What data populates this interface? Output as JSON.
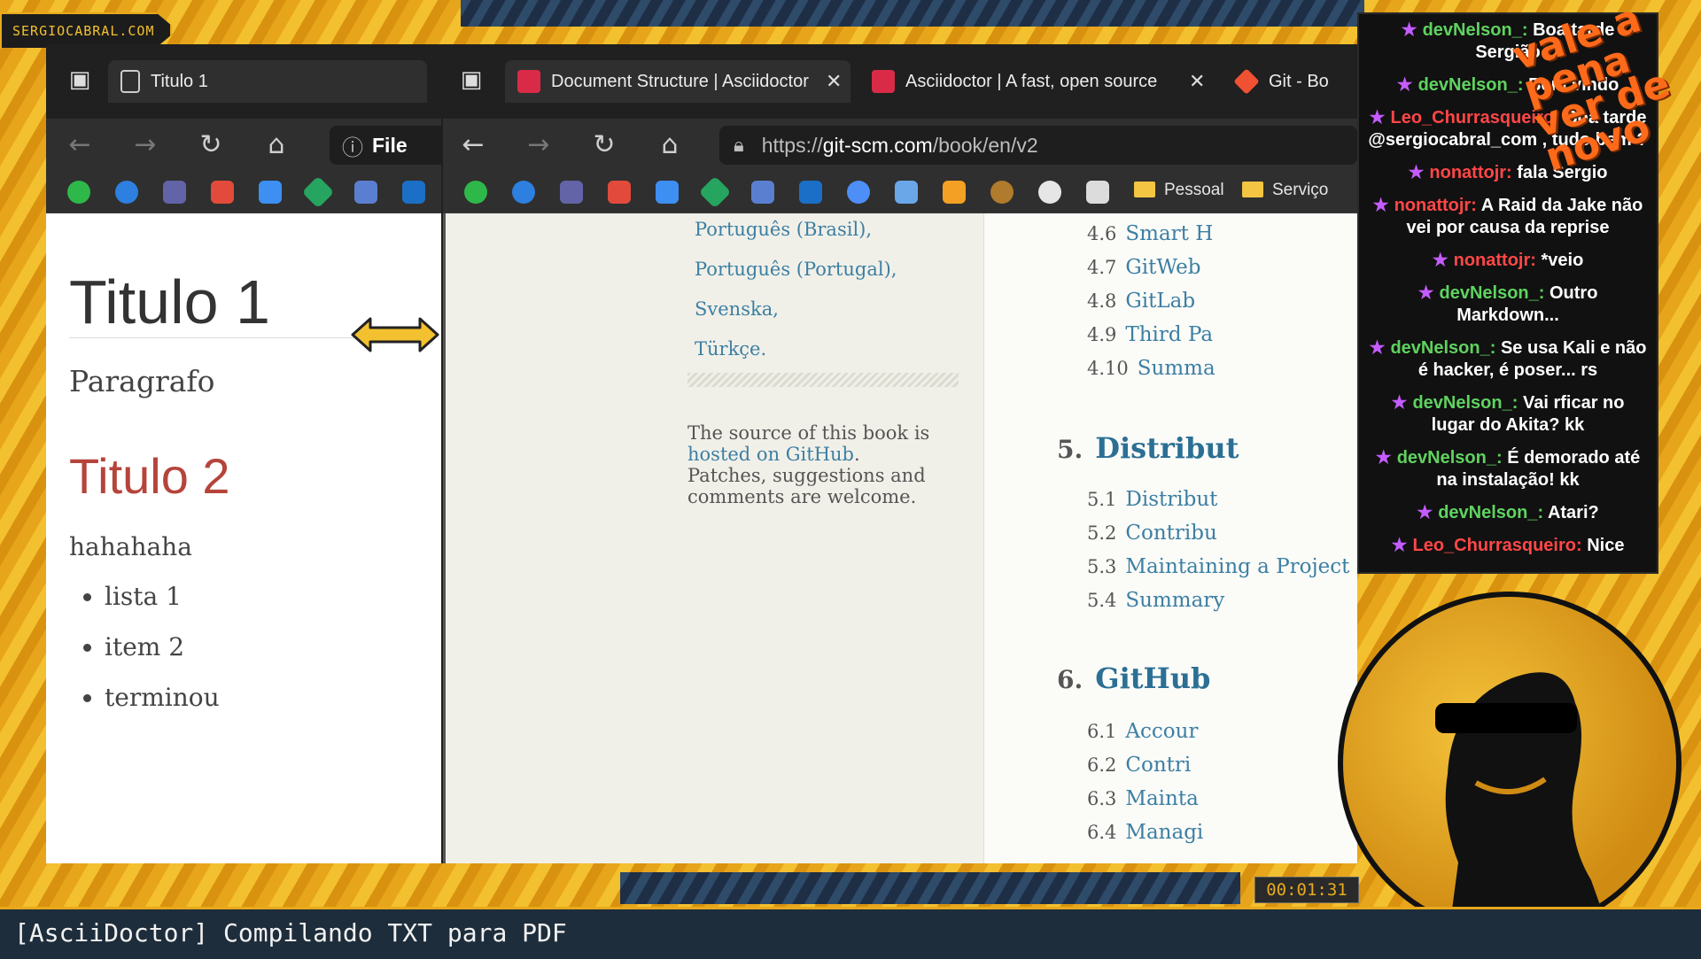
{
  "overlay": {
    "site_tag": "SERGIOCABRAL.COM",
    "timer": "00:01:31",
    "bottom_title": "[AsciiDoctor] Compilando TXT para PDF",
    "watermark": "vale a pena ver de novo"
  },
  "left_browser": {
    "tab_title": "Titulo 1",
    "url_partial": "File",
    "page": {
      "h1": "Titulo 1",
      "paragraph": "Paragrafo",
      "h2": "Titulo 2",
      "paragraph2": "hahahaha",
      "list": [
        "lista 1",
        "item 2",
        "terminou"
      ]
    }
  },
  "right_browser": {
    "tabs": [
      {
        "label": "Document Structure | Asciidoctor"
      },
      {
        "label": "Asciidoctor | A fast, open source"
      },
      {
        "label": "Git - Bo"
      }
    ],
    "url": {
      "scheme": "https://",
      "host": "git-scm.com",
      "path": "/book/en/v2"
    },
    "bookmarks": {
      "pessoal": "Pessoal",
      "servicos": "Serviço"
    },
    "languages": [
      "Português (Brasil),",
      "Português (Portugal),",
      "Svenska,",
      "Türkçe."
    ],
    "source": {
      "prefix": "The source of this book is ",
      "link": "hosted on GitHub",
      "suffix": ".",
      "line2": "Patches, suggestions and comments are welcome."
    },
    "toc": {
      "items4": [
        {
          "num": "4.6",
          "label": "Smart H"
        },
        {
          "num": "4.7",
          "label": "GitWeb"
        },
        {
          "num": "4.8",
          "label": "GitLab"
        },
        {
          "num": "4.9",
          "label": "Third Pa"
        },
        {
          "num": "4.10",
          "label": "Summa"
        }
      ],
      "chapter5": {
        "num": "5.",
        "label": "Distribut"
      },
      "items5": [
        {
          "num": "5.1",
          "label": "Distribut"
        },
        {
          "num": "5.2",
          "label": "Contribu"
        },
        {
          "num": "5.3",
          "label": "Maintaining a Project"
        },
        {
          "num": "5.4",
          "label": "Summary"
        }
      ],
      "chapter6": {
        "num": "6.",
        "label": "GitHub"
      },
      "items6": [
        {
          "num": "6.1",
          "label": "Accour"
        },
        {
          "num": "6.2",
          "label": "Contri"
        },
        {
          "num": "6.3",
          "label": "Mainta"
        },
        {
          "num": "6.4",
          "label": "Managi"
        }
      ]
    }
  },
  "chat": [
    {
      "user": "devNelson_:",
      "user_color": "green",
      "text": "Boa tarde Sergião"
    },
    {
      "user": "devNelson_:",
      "user_color": "green",
      "text": "Bem vindo"
    },
    {
      "user": "Leo_Churrasqueiro:",
      "user_color": "red",
      "text": "Boa tarde @sergiocabral_com , tudo bem ?"
    },
    {
      "user": "nonattojr:",
      "user_color": "red",
      "text": "fala Sergio"
    },
    {
      "user": "nonattojr:",
      "user_color": "red",
      "text": "A Raid da Jake não vei por causa da reprise"
    },
    {
      "user": "nonattojr:",
      "user_color": "red",
      "text": "*veio"
    },
    {
      "user": "devNelson_:",
      "user_color": "green",
      "text": "Outro Markdown..."
    },
    {
      "user": "devNelson_:",
      "user_color": "green",
      "text": "Se usa Kali e não é hacker, é poser... rs"
    },
    {
      "user": "devNelson_:",
      "user_color": "green",
      "text": "Vai rficar no lugar do Akita? kk"
    },
    {
      "user": "devNelson_:",
      "user_color": "green",
      "text": "É demorado até na instalação! kk"
    },
    {
      "user": "devNelson_:",
      "user_color": "green",
      "text": "Atari?"
    },
    {
      "user": "Leo_Churrasqueiro:",
      "user_color": "red",
      "text": "Nice"
    }
  ],
  "colors": {
    "accent": "#e8a91c",
    "link": "#3c7fa3",
    "h2": "#b5443b",
    "chat_star": "#c45cff"
  }
}
